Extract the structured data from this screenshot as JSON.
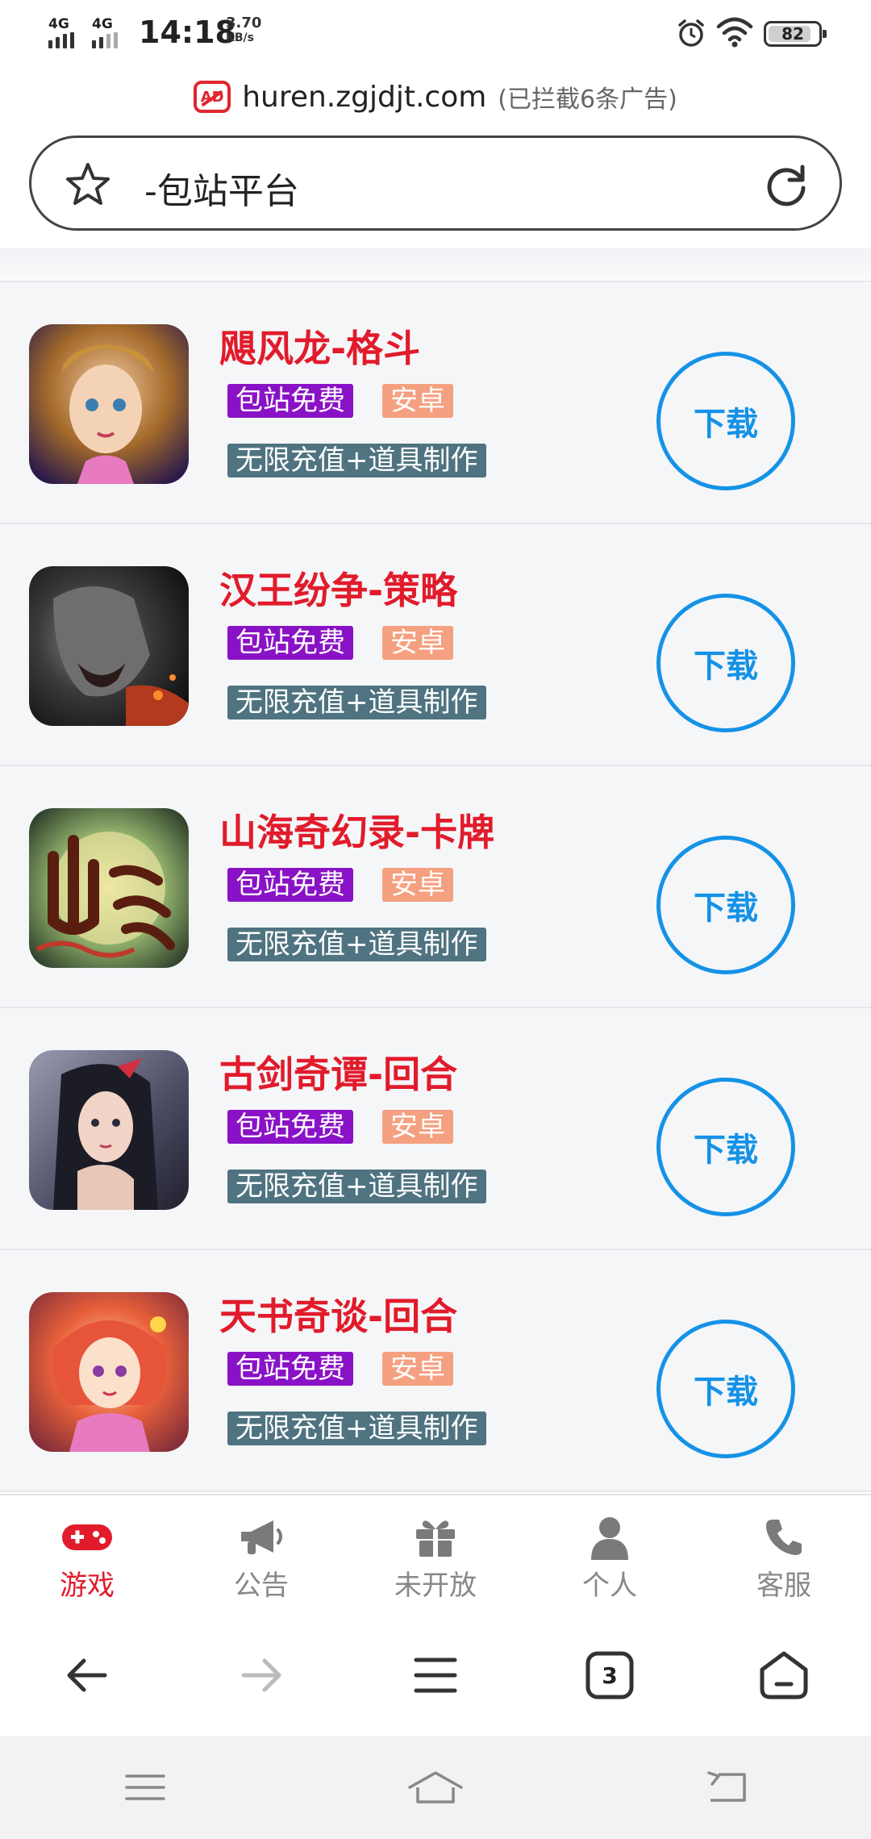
{
  "status_bar": {
    "signal1": "4G",
    "signal2": "4G",
    "time": "14:18",
    "speed_value": "3.70",
    "speed_unit": "KB/s",
    "battery": "82"
  },
  "url_bar": {
    "ad_badge": "AD",
    "domain": "huren.zgjdjt.com",
    "blocked_note": "(已拦截6条广告)"
  },
  "search": {
    "title": "-包站平台"
  },
  "games": [
    {
      "name": "飓风龙-格斗",
      "tag_free": "包站免费",
      "tag_platform": "安卓",
      "tag_feature": "无限充值+道具制作",
      "button": "下载"
    },
    {
      "name": "汉王纷争-策略",
      "tag_free": "包站免费",
      "tag_platform": "安卓",
      "tag_feature": "无限充值+道具制作",
      "button": "下载"
    },
    {
      "name": "山海奇幻录-卡牌",
      "tag_free": "包站免费",
      "tag_platform": "安卓",
      "tag_feature": "无限充值+道具制作",
      "button": "下载"
    },
    {
      "name": "古剑奇谭-回合",
      "tag_free": "包站免费",
      "tag_platform": "安卓",
      "tag_feature": "无限充值+道具制作",
      "button": "下载"
    },
    {
      "name": "天书奇谈-回合",
      "tag_free": "包站免费",
      "tag_platform": "安卓",
      "tag_feature": "无限充值+道具制作",
      "button": "下载"
    }
  ],
  "tabs": [
    {
      "label": "游戏",
      "icon": "gamepad-icon",
      "active": true
    },
    {
      "label": "公告",
      "icon": "megaphone-icon",
      "active": false
    },
    {
      "label": "未开放",
      "icon": "gift-icon",
      "active": false
    },
    {
      "label": "个人",
      "icon": "person-icon",
      "active": false
    },
    {
      "label": "客服",
      "icon": "phone-icon",
      "active": false
    }
  ],
  "browser_nav": {
    "tab_count": "3"
  },
  "colors": {
    "accent_red": "#e11b2b",
    "download_blue": "#1592e6",
    "tag_purple": "#8a12c6",
    "tag_salmon": "#f5a080",
    "tag_slate": "#4f7380"
  }
}
